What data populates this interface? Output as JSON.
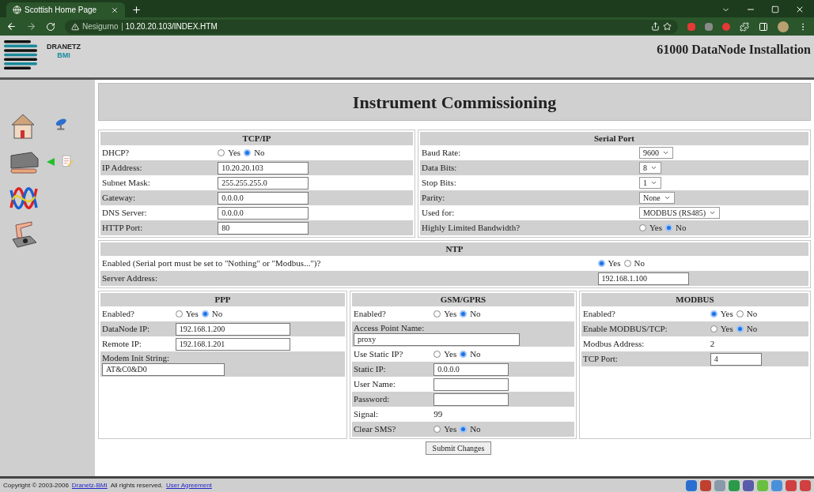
{
  "browser": {
    "tab_title": "Scottish Home Page",
    "security_label": "Nesigurno",
    "url": "10.20.20.103/INDEX.HTM"
  },
  "header": {
    "logo_top": "DRANETZ",
    "logo_bottom": "BMI",
    "title": "61000 DataNode Installation"
  },
  "page_title": "Instrument Commissioning",
  "tcpip": {
    "title": "TCP/IP",
    "rows": [
      {
        "kind": "radio",
        "label": "DHCP?",
        "options": [
          {
            "label": "Yes",
            "selected": false
          },
          {
            "label": "No",
            "selected": true
          }
        ]
      },
      {
        "kind": "input",
        "label": "IP Address:",
        "value": "10.20.20.103"
      },
      {
        "kind": "input",
        "label": "Subnet Mask:",
        "value": "255.255.255.0"
      },
      {
        "kind": "input",
        "label": "Gateway:",
        "value": "0.0.0.0"
      },
      {
        "kind": "input",
        "label": "DNS Server:",
        "value": "0.0.0.0"
      },
      {
        "kind": "input",
        "label": "HTTP Port:",
        "value": "80"
      }
    ]
  },
  "serial": {
    "title": "Serial Port",
    "rows": [
      {
        "kind": "select",
        "label": "Baud Rate:",
        "value": "9600"
      },
      {
        "kind": "select",
        "label": "Data Bits:",
        "value": "8"
      },
      {
        "kind": "select",
        "label": "Stop Bits:",
        "value": "1"
      },
      {
        "kind": "select",
        "label": "Parity:",
        "value": "None"
      },
      {
        "kind": "select",
        "label": "Used for:",
        "value": "MODBUS (RS485)"
      },
      {
        "kind": "radio",
        "label": "Highly Limited Bandwidth?",
        "options": [
          {
            "label": "Yes",
            "selected": false
          },
          {
            "label": "No",
            "selected": true
          }
        ]
      }
    ]
  },
  "ntp": {
    "title": "NTP",
    "rows": [
      {
        "kind": "radio",
        "label": "Enabled (Serial port must be set to \"Nothing\" or \"Modbus...\")?",
        "options": [
          {
            "label": "Yes",
            "selected": true
          },
          {
            "label": "No",
            "selected": false
          }
        ]
      },
      {
        "kind": "input",
        "label": "Server Address:",
        "value": "192.168.1.100"
      }
    ]
  },
  "ppp": {
    "title": "PPP",
    "rows": [
      {
        "kind": "radio",
        "label": "Enabled?",
        "options": [
          {
            "label": "Yes",
            "selected": false
          },
          {
            "label": "No",
            "selected": true
          }
        ]
      },
      {
        "kind": "input",
        "label": "DataNode IP:",
        "value": "192.168.1.200"
      },
      {
        "kind": "input",
        "label": "Remote IP:",
        "value": "192.168.1.201"
      },
      {
        "kind": "stacked",
        "label": "Modem Init String:",
        "value": "AT&C0&D0"
      }
    ]
  },
  "gsm": {
    "title": "GSM/GPRS",
    "rows": [
      {
        "kind": "radio",
        "label": "Enabled?",
        "options": [
          {
            "label": "Yes",
            "selected": false
          },
          {
            "label": "No",
            "selected": true
          }
        ]
      },
      {
        "kind": "stacked",
        "label": "Access Point Name:",
        "value": "proxy"
      },
      {
        "kind": "radio",
        "label": "Use Static IP?",
        "options": [
          {
            "label": "Yes",
            "selected": false
          },
          {
            "label": "No",
            "selected": true
          }
        ]
      },
      {
        "kind": "input",
        "label": "Static IP:",
        "value": "0.0.0.0"
      },
      {
        "kind": "input",
        "label": "User Name:"
      },
      {
        "kind": "input",
        "label": "Password:"
      },
      {
        "kind": "text",
        "label": "Signal:",
        "value": "99"
      },
      {
        "kind": "radio",
        "label": "Clear SMS?",
        "options": [
          {
            "label": "Yes",
            "selected": false
          },
          {
            "label": "No",
            "selected": true
          }
        ]
      }
    ]
  },
  "modbus": {
    "title": "MODBUS",
    "rows": [
      {
        "kind": "radio",
        "label": "Enabled?",
        "options": [
          {
            "label": "Yes",
            "selected": true
          },
          {
            "label": "No",
            "selected": false
          }
        ]
      },
      {
        "kind": "radio",
        "label": "Enable MODBUS/TCP:",
        "options": [
          {
            "label": "Yes",
            "selected": false
          },
          {
            "label": "No",
            "selected": true
          }
        ]
      },
      {
        "kind": "text",
        "label": "Modbus Address:",
        "value": "2"
      },
      {
        "kind": "input",
        "label": "TCP Port:",
        "value": "4"
      }
    ]
  },
  "submit_button": "Submit Changes",
  "footer": {
    "parts": [
      {
        "kind": "text",
        "text": "Copyright © 2003-2006"
      },
      {
        "kind": "link",
        "text": "Dranetz-BMI"
      },
      {
        "kind": "text",
        "text": "All rights reserved."
      },
      {
        "kind": "link",
        "text": "User Agreement"
      }
    ]
  }
}
